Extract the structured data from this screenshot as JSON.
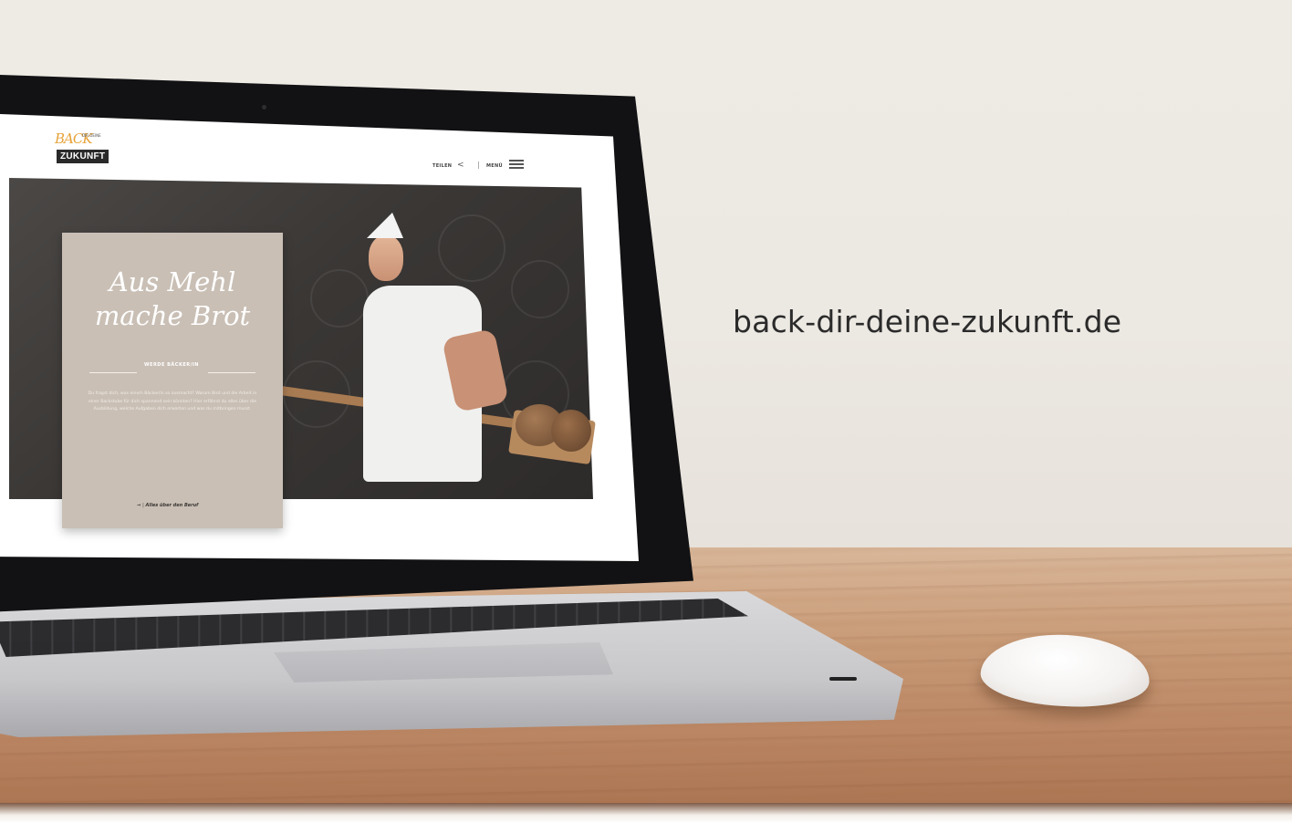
{
  "scene": {
    "url_text": "back-dir-deine-zukunft.de"
  },
  "website": {
    "logo": {
      "line1": "BACK",
      "line2_small": "DIR DEINE",
      "line3": "ZUKUNFT"
    },
    "nav": {
      "share_label": "TEILEN",
      "share_icon": "share-icon",
      "menu_label": "MENÜ",
      "menu_icon": "hamburger-icon"
    },
    "hero": {
      "headline": "Aus Mehl\nmache Brot",
      "label": "WERDE BÄCKER/IN",
      "body": "Du fragst dich, was eine/n Bäcker/in so ausmacht? Warum Brot und die Arbeit in einer Backstube für dich spannend sein könnten? Hier erfährst du alles über die Ausbildung, welche Aufgaben dich erwarten und was du mitbringen musst.",
      "cta": "Alles über den Beruf",
      "cta_arrow": "→"
    },
    "colors": {
      "accent": "#e7a33a",
      "card": "#c9bfb5",
      "hero_bg": "#3a3735"
    }
  }
}
